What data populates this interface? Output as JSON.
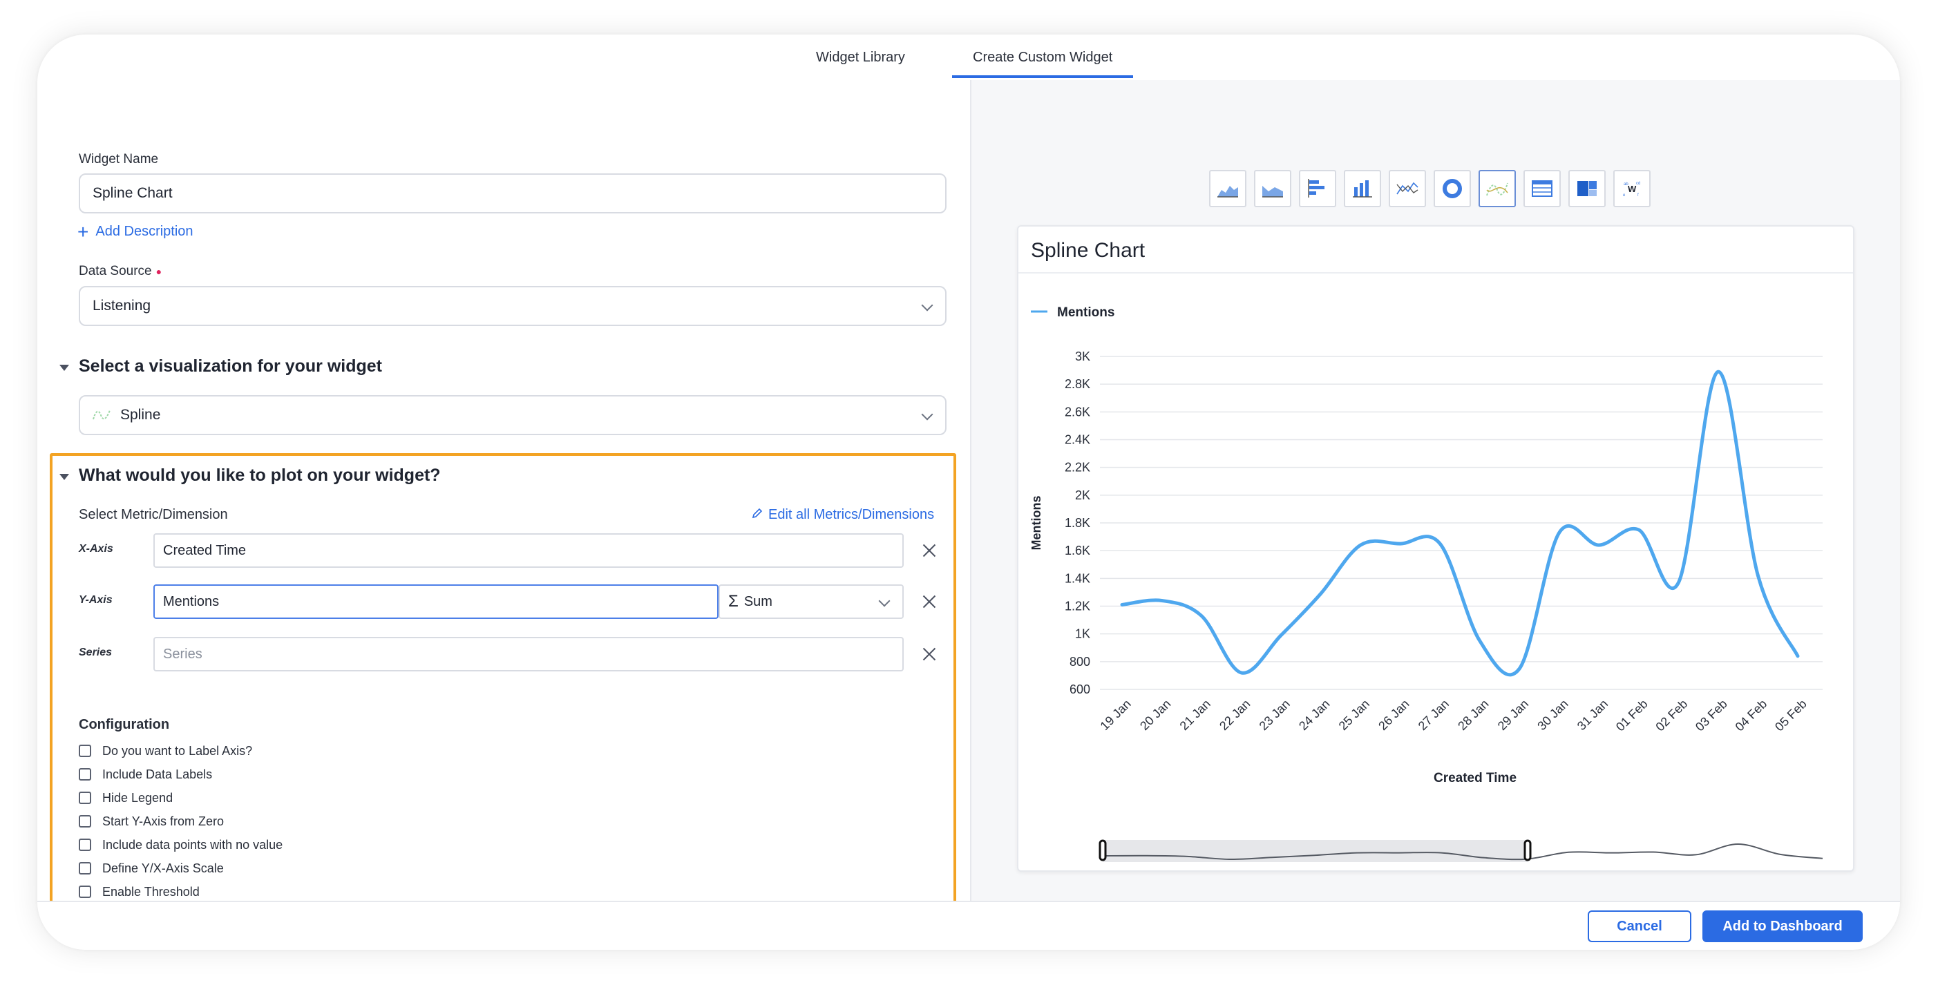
{
  "tabs": [
    {
      "label": "Widget Library",
      "active": false
    },
    {
      "label": "Create Custom Widget",
      "active": true
    }
  ],
  "form": {
    "widget_name_label": "Widget Name",
    "widget_name_value": "Spline Chart",
    "add_description": "Add Description",
    "data_source_label": "Data Source",
    "data_source_value": "Listening",
    "vis_section_title": "Select a visualization for your widget",
    "vis_value": "Spline",
    "plot_section_title": "What would you like to plot on your widget?",
    "metric_label": "Select Metric/Dimension",
    "edit_all": "Edit all Metrics/Dimensions",
    "x_axis_label": "X-Axis",
    "x_axis_value": "Created Time",
    "y_axis_label": "Y-Axis",
    "y_axis_value": "Mentions",
    "aggregation_symbol": "Σ",
    "aggregation_value": "Sum",
    "series_label": "Series",
    "series_placeholder": "Series",
    "configuration_title": "Configuration",
    "config_options": [
      "Do you want to Label Axis?",
      "Include Data Labels",
      "Hide Legend",
      "Start Y-Axis from Zero",
      "Include data points with no value",
      "Define Y/X-Axis Scale",
      "Enable Threshold"
    ]
  },
  "vis_icons": [
    "area-chart-icon",
    "stacked-area-icon",
    "bar-chart-icon",
    "column-chart-icon",
    "line-chart-icon",
    "donut-chart-icon",
    "spline-chart-icon",
    "table-icon",
    "treemap-icon",
    "word-cloud-icon"
  ],
  "selected_vis_icon": "spline-chart-icon",
  "preview": {
    "title": "Spline Chart"
  },
  "colors": {
    "accent": "#2b6be3",
    "series": "#4ea7ee",
    "highlight_border": "#f3a323"
  },
  "chart_data": {
    "type": "line",
    "title": "",
    "xlabel": "Created Time",
    "ylabel": "Mentions",
    "ylim": [
      600,
      3000
    ],
    "y_ticks": [
      "600",
      "800",
      "1K",
      "1.2K",
      "1.4K",
      "1.6K",
      "1.8K",
      "2K",
      "2.2K",
      "2.4K",
      "2.6K",
      "2.8K",
      "3K"
    ],
    "y_tick_values": [
      600,
      800,
      1000,
      1200,
      1400,
      1600,
      1800,
      2000,
      2200,
      2400,
      2600,
      2800,
      3000
    ],
    "categories": [
      "19 Jan",
      "20 Jan",
      "21 Jan",
      "22 Jan",
      "23 Jan",
      "24 Jan",
      "25 Jan",
      "26 Jan",
      "27 Jan",
      "28 Jan",
      "29 Jan",
      "30 Jan",
      "31 Jan",
      "01 Feb",
      "02 Feb",
      "03 Feb",
      "04 Feb",
      "05 Feb"
    ],
    "legend_position": "top-left",
    "grid": true,
    "series": [
      {
        "name": "Mentions",
        "values": [
          1210,
          1240,
          1130,
          720,
          990,
          1290,
          1640,
          1650,
          1650,
          950,
          750,
          1730,
          1640,
          1750,
          1370,
          2890,
          1420,
          840
        ]
      }
    ]
  },
  "buttons": {
    "cancel": "Cancel",
    "add": "Add to Dashboard"
  }
}
